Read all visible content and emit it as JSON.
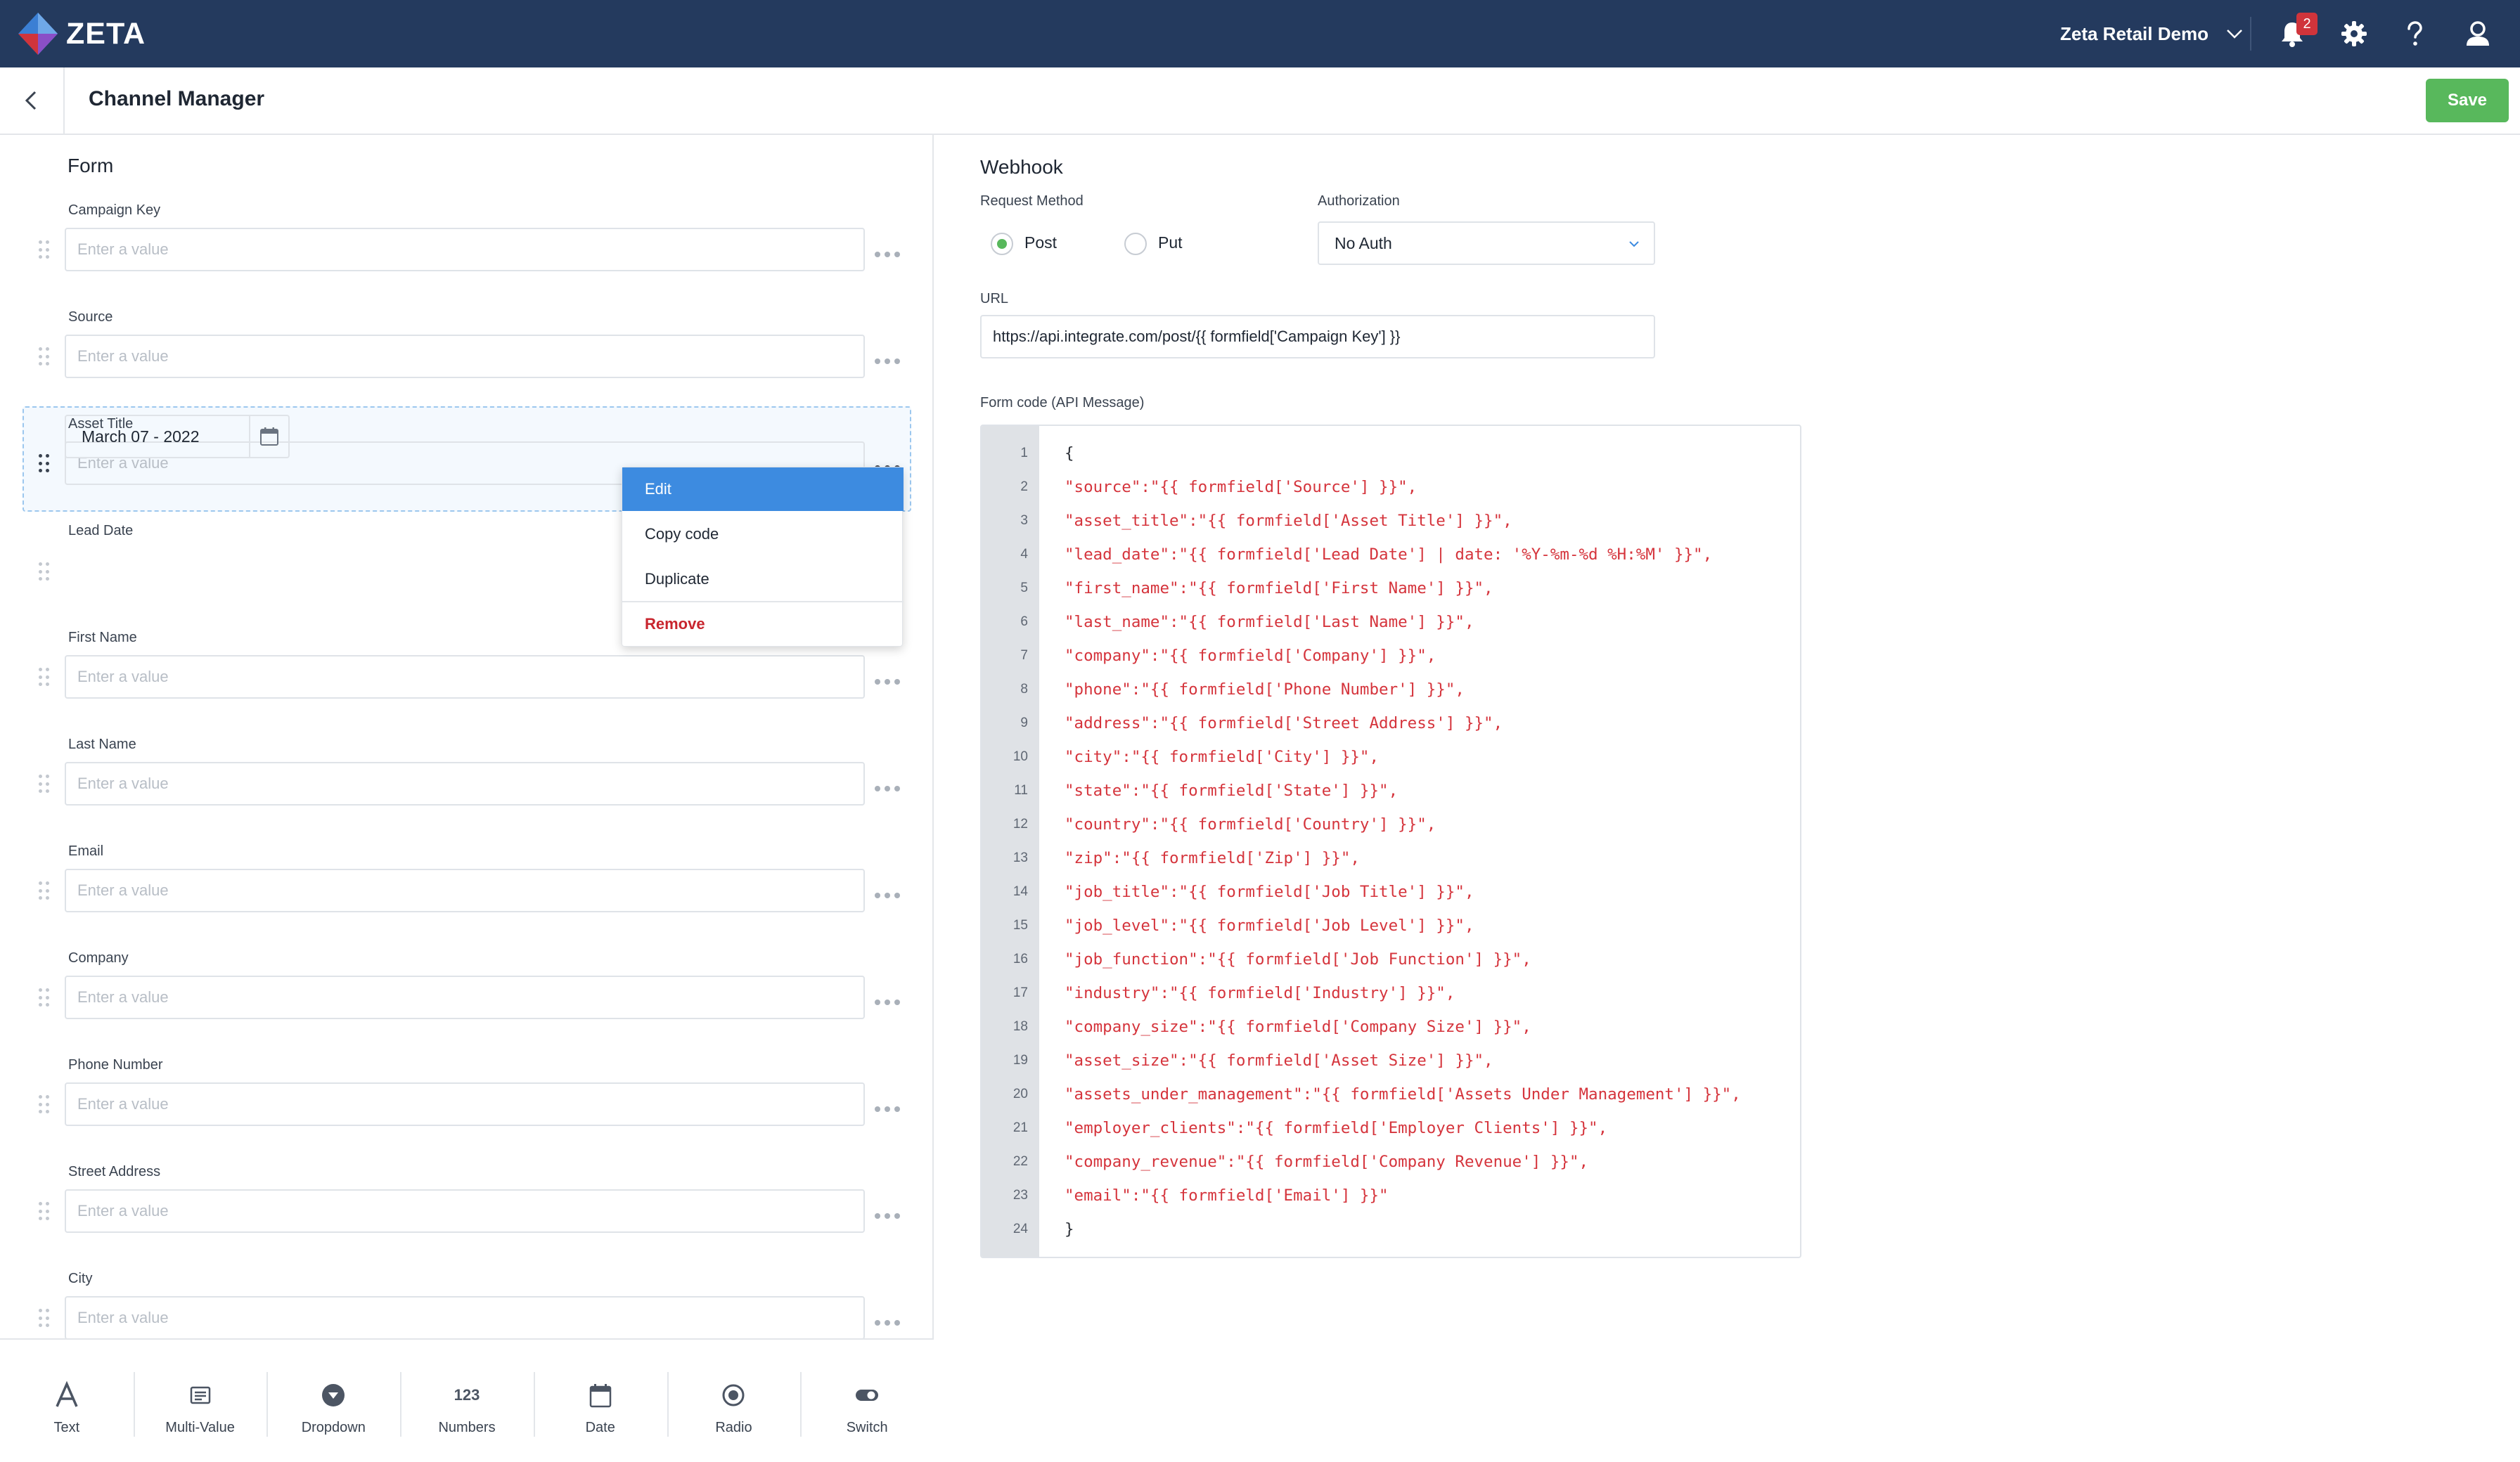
{
  "app": {
    "logo_text": "ZETA",
    "account_name": "Zeta Retail Demo",
    "notification_count": "2",
    "colors": {
      "topbar": "#243a5e",
      "accent": "#3d8be0",
      "save": "#58b85c",
      "danger": "#c8252e",
      "code": "#d5343c"
    }
  },
  "header": {
    "title": "Channel Manager",
    "save_label": "Save",
    "back_icon": "chevron-left-icon"
  },
  "form": {
    "title": "Form",
    "fields": [
      {
        "label": "Campaign Key",
        "placeholder": "Enter a value"
      },
      {
        "label": "Source",
        "placeholder": "Enter a value"
      },
      {
        "label": "Asset Title",
        "placeholder": "Enter a value"
      },
      {
        "label": "Lead Date",
        "value": "March 07 - 2022"
      },
      {
        "label": "First Name",
        "placeholder": "Enter a value"
      },
      {
        "label": "Last Name",
        "placeholder": "Enter a value"
      },
      {
        "label": "Email",
        "placeholder": "Enter a value"
      },
      {
        "label": "Company",
        "placeholder": "Enter a value"
      },
      {
        "label": "Phone Number",
        "placeholder": "Enter a value"
      },
      {
        "label": "Street Address",
        "placeholder": "Enter a value"
      },
      {
        "label": "City",
        "placeholder": "Enter a value"
      }
    ]
  },
  "context_menu": {
    "items": [
      "Edit",
      "Copy code",
      "Duplicate",
      "Remove"
    ]
  },
  "palette": {
    "items": [
      {
        "label": "Text",
        "icon": "text-icon"
      },
      {
        "label": "Multi-Value",
        "icon": "list-icon"
      },
      {
        "label": "Dropdown",
        "icon": "dropdown-icon"
      },
      {
        "label": "Numbers",
        "icon": "numbers-icon",
        "glyph": "123"
      },
      {
        "label": "Date",
        "icon": "calendar-icon"
      },
      {
        "label": "Radio",
        "icon": "radio-icon"
      },
      {
        "label": "Switch",
        "icon": "switch-icon"
      }
    ]
  },
  "webhook": {
    "title": "Webhook",
    "request_method_label": "Request Method",
    "methods": [
      "Post",
      "Put"
    ],
    "selected_method": "Post",
    "authorization_label": "Authorization",
    "authorization_value": "No Auth",
    "url_label": "URL",
    "url_value": "https://api.integrate.com/post/{{ formfield['Campaign Key'] }}",
    "code_label": "Form code (API Message)",
    "code_lines": [
      "{",
      "\"source\":\"{{ formfield['Source'] }}\",",
      "\"asset_title\":\"{{ formfield['Asset Title'] }}\",",
      "\"lead_date\":\"{{ formfield['Lead Date'] | date: '%Y-%m-%d %H:%M' }}\",",
      "\"first_name\":\"{{ formfield['First Name'] }}\",",
      "\"last_name\":\"{{ formfield['Last Name'] }}\",",
      "\"company\":\"{{ formfield['Company'] }}\",",
      "\"phone\":\"{{ formfield['Phone Number'] }}\",",
      "\"address\":\"{{ formfield['Street Address'] }}\",",
      "\"city\":\"{{ formfield['City'] }}\",",
      "\"state\":\"{{ formfield['State'] }}\",",
      "\"country\":\"{{ formfield['Country'] }}\",",
      "\"zip\":\"{{ formfield['Zip'] }}\",",
      "\"job_title\":\"{{ formfield['Job Title'] }}\",",
      "\"job_level\":\"{{ formfield['Job Level'] }}\",",
      "\"job_function\":\"{{ formfield['Job Function'] }}\",",
      "\"industry\":\"{{ formfield['Industry'] }}\",",
      "\"company_size\":\"{{ formfield['Company Size'] }}\",",
      "\"asset_size\":\"{{ formfield['Asset Size'] }}\",",
      "\"assets_under_management\":\"{{ formfield['Assets Under Management'] }}\",",
      "\"employer_clients\":\"{{ formfield['Employer Clients'] }}\",",
      "\"company_revenue\":\"{{ formfield['Company Revenue'] }}\",",
      "\"email\":\"{{ formfield['Email'] }}\"",
      "}"
    ]
  }
}
